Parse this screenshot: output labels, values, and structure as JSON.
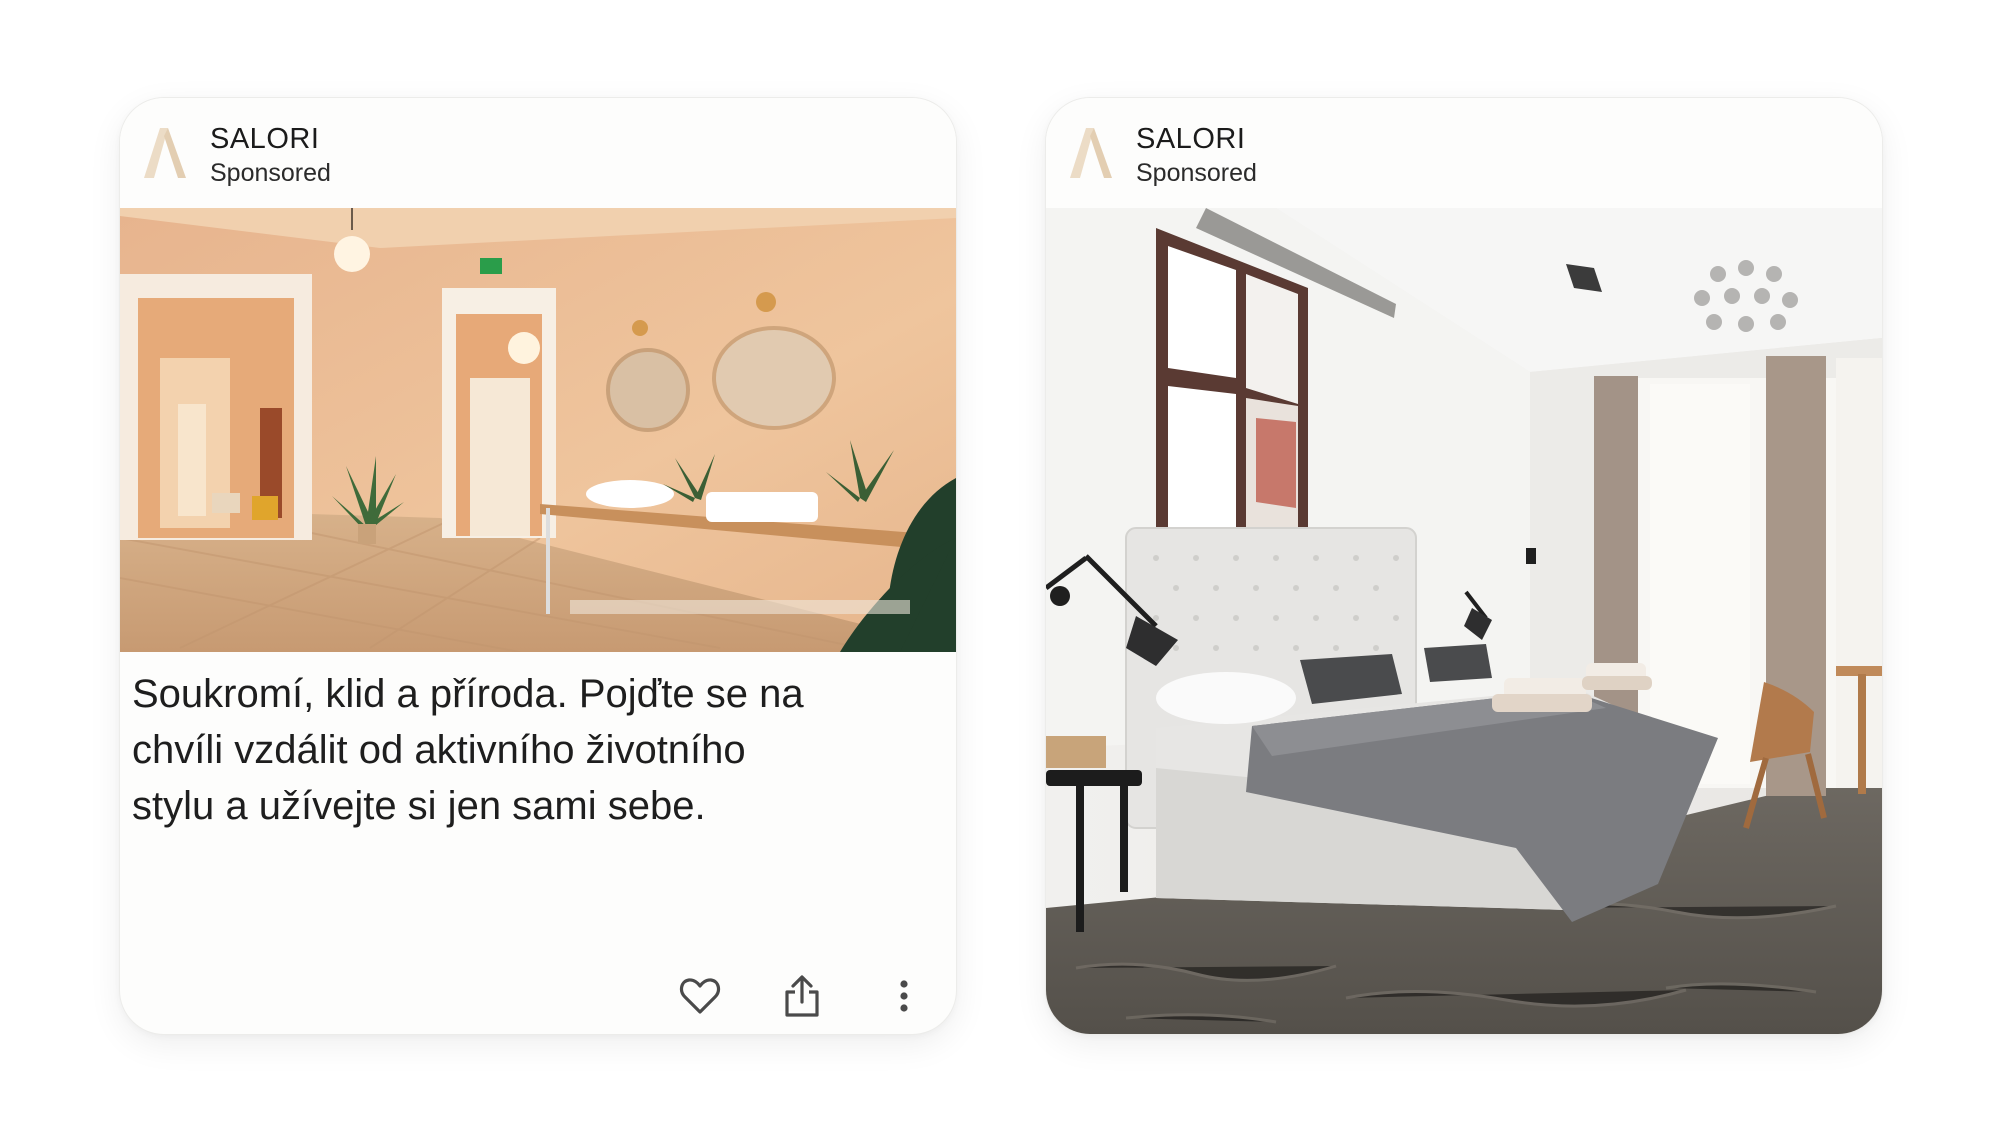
{
  "ads": [
    {
      "brand": "SALORI",
      "label": "Sponsored",
      "photo_icon": "hotel-bathroom-photo",
      "text": "Soukromí, klid a příroda. Pojďte se na chvíli vzdálit od aktivního životního stylu a užívejte si jen sami sebe.",
      "text_lines": [
        "Soukromí, klid a příroda. Pojďte se na",
        "chvíli vzdálit od aktivního životního",
        "stylu a užívejte si jen sami sebe."
      ],
      "actions": [
        {
          "icon": "heart-icon"
        },
        {
          "icon": "share-icon"
        },
        {
          "icon": "more-vertical-icon"
        }
      ]
    },
    {
      "brand": "SALORI",
      "label": "Sponsored",
      "photo_icon": "hotel-bedroom-photo"
    }
  ],
  "colors": {
    "logo": "#e8d6bf",
    "text": "#1e1e1e",
    "card_bg": "#fdfdfc",
    "icon": "#4a4a4a"
  }
}
